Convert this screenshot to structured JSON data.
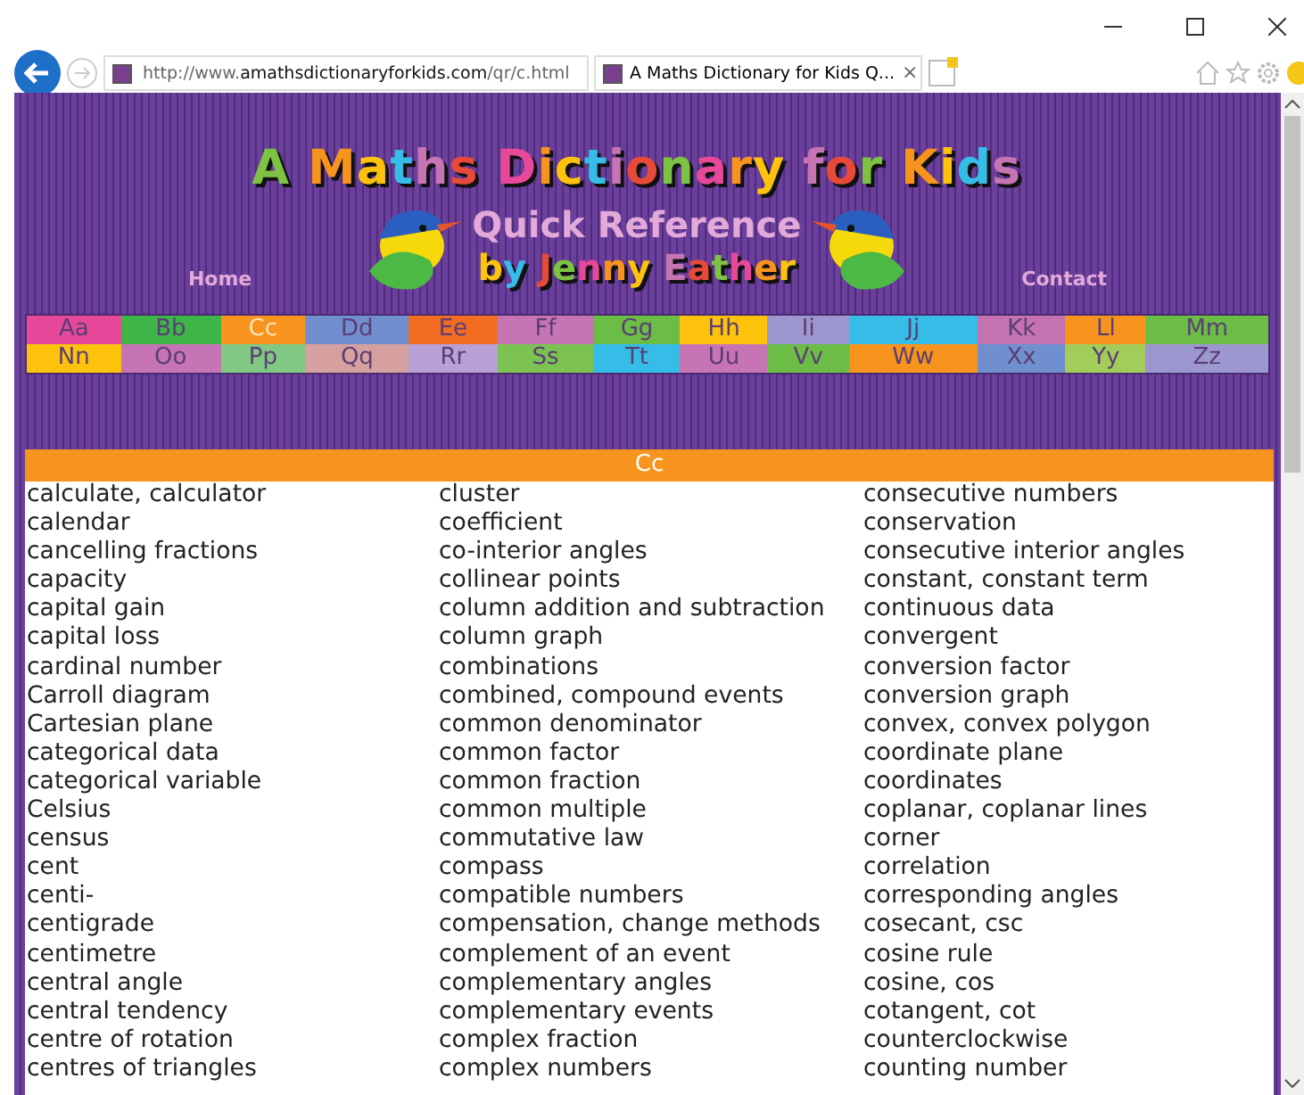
{
  "browser": {
    "url_prefix": "http://www.",
    "url_domain": "amathsdictionaryforkids.com",
    "url_path": "/qr/c.html",
    "tab_title": "A Maths Dictionary for Kids Q...",
    "tab_close": "×"
  },
  "header": {
    "title": "A Maths Dictionary for Kids",
    "subtitle": "Quick Reference",
    "byline": "by Jenny Eather",
    "nav": [
      {
        "label": "Home"
      },
      {
        "label": "Contact"
      }
    ]
  },
  "letters": [
    [
      {
        "label": "Aa",
        "color": "#e8489a",
        "selected": false
      },
      {
        "label": "Bb",
        "color": "#3db549",
        "selected": false
      },
      {
        "label": "Cc",
        "color": "#f7941d",
        "selected": true
      },
      {
        "label": "Dd",
        "color": "#6f8fcf",
        "selected": false
      },
      {
        "label": "Ee",
        "color": "#f26c22",
        "selected": false
      },
      {
        "label": "Ff",
        "color": "#c774b4",
        "selected": false
      },
      {
        "label": "Gg",
        "color": "#6bbd45",
        "selected": false
      },
      {
        "label": "Hh",
        "color": "#fdc30c",
        "selected": false
      },
      {
        "label": "Ii",
        "color": "#9d97cf",
        "selected": false
      },
      {
        "label": "Jj",
        "color": "#35bde8",
        "selected": false
      },
      {
        "label": "Kk",
        "color": "#c472b0",
        "selected": false
      },
      {
        "label": "Ll",
        "color": "#f7941d",
        "selected": false
      },
      {
        "label": "Mm",
        "color": "#6bbd45",
        "selected": false
      }
    ],
    [
      {
        "label": "Nn",
        "color": "#fdc30c",
        "selected": false
      },
      {
        "label": "Oo",
        "color": "#c774b4",
        "selected": false
      },
      {
        "label": "Pp",
        "color": "#80c883",
        "selected": false
      },
      {
        "label": "Qq",
        "color": "#d7a0a0",
        "selected": false
      },
      {
        "label": "Rr",
        "color": "#b7a1d6",
        "selected": false
      },
      {
        "label": "Ss",
        "color": "#7cc252",
        "selected": false
      },
      {
        "label": "Tt",
        "color": "#35bde8",
        "selected": false
      },
      {
        "label": "Uu",
        "color": "#c774b4",
        "selected": false
      },
      {
        "label": "Vv",
        "color": "#6bbd45",
        "selected": false
      },
      {
        "label": "Ww",
        "color": "#f7941d",
        "selected": false
      },
      {
        "label": "Xx",
        "color": "#6f8fcf",
        "selected": false
      },
      {
        "label": "Yy",
        "color": "#a2cd5a",
        "selected": false
      },
      {
        "label": "Zz",
        "color": "#9d97cf",
        "selected": false
      }
    ]
  ],
  "section": {
    "heading": "Cc"
  },
  "words": [
    [
      "calculate, calculator",
      "calendar",
      "cancelling fractions",
      "capacity",
      "capital gain",
      "capital loss",
      "cardinal number",
      "Carroll diagram",
      "Cartesian plane",
      "categorical data",
      "categorical variable",
      "Celsius",
      "census",
      "cent",
      "centi-",
      "centigrade",
      "centimetre",
      "central angle",
      "central tendency",
      "centre of rotation",
      "centres of triangles"
    ],
    [
      "cluster",
      "coefficient",
      "co-interior angles",
      "collinear points",
      "column addition and subtraction",
      "column graph",
      "combinations",
      "combined, compound events",
      "common denominator",
      "common factor",
      "common fraction",
      "common multiple",
      "commutative law",
      "compass",
      "compatible numbers",
      "compensation, change methods",
      "complement of an event",
      "complementary angles",
      "complementary events",
      "complex fraction",
      "complex numbers"
    ],
    [
      "consecutive numbers",
      "conservation",
      "consecutive interior angles",
      "constant, constant term",
      "continuous data",
      "convergent",
      "conversion factor",
      "conversion graph",
      "convex, convex polygon",
      "coordinate plane",
      "coordinates",
      "coplanar, coplanar lines",
      "corner",
      "correlation",
      "corresponding angles",
      "cosecant, csc",
      "cosine rule",
      "cosine, cos",
      "cotangent, cot",
      "counterclockwise",
      "counting number"
    ]
  ]
}
